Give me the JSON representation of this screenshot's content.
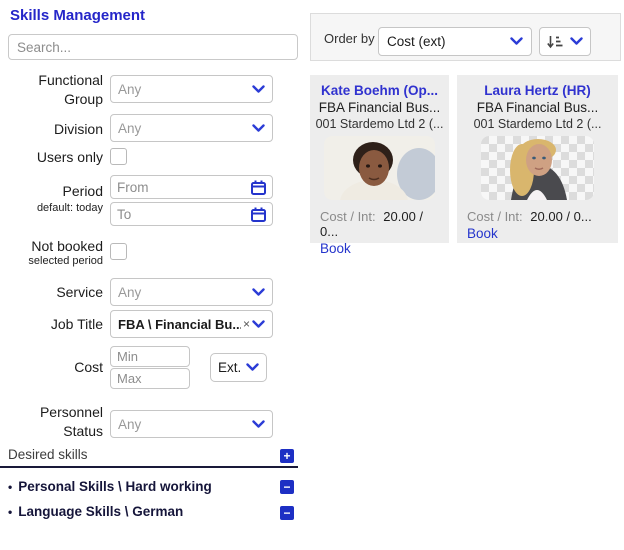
{
  "app": {
    "title": "Skills Management"
  },
  "search": {
    "placeholder": "Search..."
  },
  "filters": {
    "functional_group": {
      "label": "Functional Group",
      "value": "Any"
    },
    "division": {
      "label": "Division",
      "value": "Any"
    },
    "users_only": {
      "label": "Users only"
    },
    "period": {
      "label": "Period",
      "note": "default: today",
      "from_placeholder": "From",
      "to_placeholder": "To"
    },
    "not_booked": {
      "label": "Not booked",
      "note": "selected period"
    },
    "service": {
      "label": "Service",
      "value": "Any"
    },
    "job_title": {
      "label": "Job Title",
      "value": "FBA \\ Financial Bu...",
      "clear_icon": "×"
    },
    "cost": {
      "label": "Cost",
      "min_placeholder": "Min",
      "max_placeholder": "Max",
      "currency_value": "Ext."
    },
    "personnel_status": {
      "label": "Personnel Status",
      "value": "Any"
    }
  },
  "desired_skills": {
    "title": "Desired skills",
    "add_icon": "+",
    "remove_icon": "−",
    "items": [
      {
        "label": "Personal Skills \\ Hard working"
      },
      {
        "label": "Language Skills \\ German"
      }
    ]
  },
  "order_bar": {
    "label": "Order by",
    "value": "Cost (ext)"
  },
  "results": {
    "cards": [
      {
        "name": "Kate Boehm (Op...",
        "role": "FBA Financial Bus...",
        "company": "001 Stardemo Ltd 2 (...",
        "cost_label": "Cost / Int:",
        "cost_value": "20.00 / 0...",
        "book_label": "Book"
      },
      {
        "name": "Laura Hertz (HR)",
        "role": "FBA Financial Bus...",
        "company": "001 Stardemo Ltd 2 (...",
        "cost_label": "Cost / Int:",
        "cost_value": "20.00 / 0...",
        "book_label": "Book"
      }
    ]
  },
  "colors": {
    "accent_blue": "#2b3cd6",
    "link_blue": "#3032cf",
    "card_bg": "#ededed",
    "button_blue": "#1d2fc4"
  }
}
